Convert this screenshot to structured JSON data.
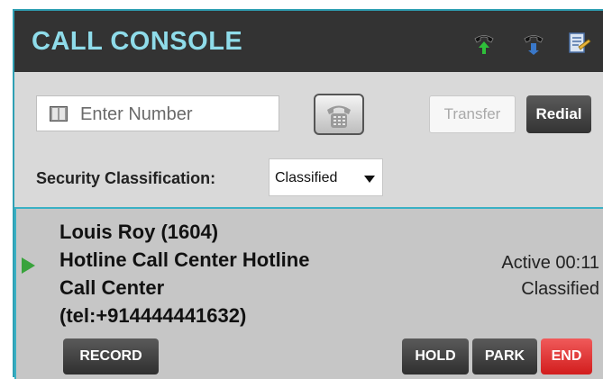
{
  "header": {
    "title": "CALL CONSOLE",
    "icons": [
      "phone-up-icon",
      "phone-transfer-icon",
      "notes-icon"
    ]
  },
  "dialer": {
    "number_placeholder": "Enter Number",
    "transfer_label": "Transfer",
    "redial_label": "Redial"
  },
  "security": {
    "label": "Security Classification:",
    "selected": "Classified"
  },
  "call": {
    "caller_lines": [
      "Louis Roy (1604)",
      "Hotline Call Center Hotline",
      "Call Center",
      "(tel:+914444441632)"
    ],
    "status": "Active 00:11",
    "classification": "Classified",
    "buttons": {
      "record": "RECORD",
      "hold": "HOLD",
      "park": "PARK",
      "end": "END"
    }
  },
  "colors": {
    "header_bg": "#333333",
    "title": "#8fdcea",
    "border_accent": "#2fa0b4",
    "end_button": "#d21d1d",
    "active_indicator": "#39a33c"
  }
}
